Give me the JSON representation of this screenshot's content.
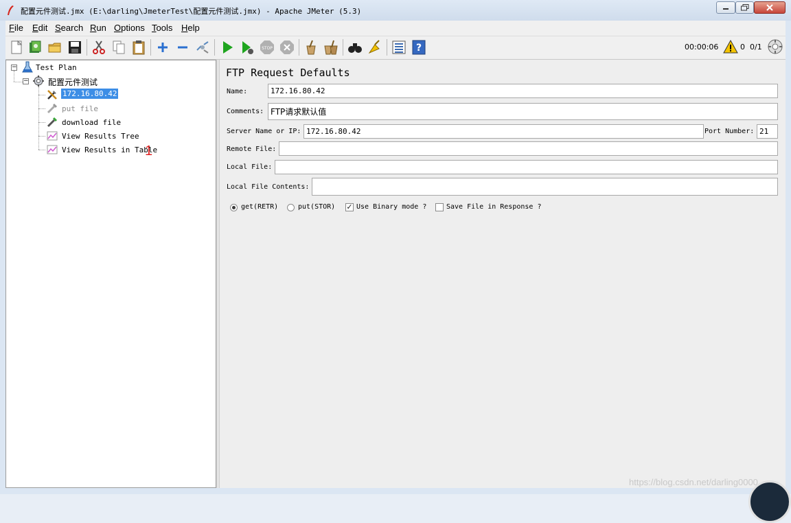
{
  "window": {
    "title": "配置元件测试.jmx (E:\\darling\\JmeterTest\\配置元件测试.jmx) - Apache JMeter (5.3)"
  },
  "menu": {
    "items": [
      {
        "mnemonic": "F",
        "rest": "ile"
      },
      {
        "mnemonic": "E",
        "rest": "dit"
      },
      {
        "mnemonic": "S",
        "rest": "earch"
      },
      {
        "mnemonic": "R",
        "rest": "un"
      },
      {
        "mnemonic": "O",
        "rest": "ptions"
      },
      {
        "mnemonic": "T",
        "rest": "ools"
      },
      {
        "mnemonic": "H",
        "rest": "elp"
      }
    ]
  },
  "toolbar": {
    "icons": [
      "new-icon",
      "templates-icon",
      "open-icon",
      "save-icon",
      "cut-icon",
      "copy-icon",
      "paste-icon",
      "expand-icon",
      "collapse-icon",
      "toggle-icon",
      "start-icon",
      "start-no-pause-icon",
      "stop-icon",
      "shutdown-icon",
      "clear-icon",
      "clear-all-icon",
      "search-icon",
      "reset-search-icon",
      "function-helper-icon",
      "help-icon"
    ],
    "timer": "00:00:06",
    "warning_count": "0",
    "threads": "0/1"
  },
  "tree": {
    "root": "Test Plan",
    "thread_group": "配置元件测试",
    "children": [
      {
        "label": "172.16.80.42",
        "selected": true,
        "disabled": false
      },
      {
        "label": "put file",
        "selected": false,
        "disabled": true
      },
      {
        "label": "download file",
        "selected": false,
        "disabled": false
      },
      {
        "label": "View Results Tree",
        "selected": false,
        "disabled": false
      },
      {
        "label": "View Results in Table",
        "selected": false,
        "disabled": false
      }
    ],
    "annotation": "1"
  },
  "panel": {
    "title": "FTP Request Defaults",
    "name_label": "Name:",
    "name_value": "172.16.80.42",
    "comments_label": "Comments:",
    "comments_value": "FTP请求默认值",
    "server_label": "Server Name or IP:",
    "server_value": "172.16.80.42",
    "port_label": "Port Number:",
    "port_value": "21",
    "remote_label": "Remote File:",
    "remote_value": "",
    "local_label": "Local File:",
    "local_value": "",
    "contents_label": "Local File Contents:",
    "contents_value": "",
    "get_label": "get(RETR)",
    "put_label": "put(STOR)",
    "binary_label": "Use Binary mode ?",
    "save_label": "Save File in Response ?",
    "get_selected": true,
    "binary_checked": true,
    "save_checked": false
  },
  "watermark": "https://blog.csdn.net/darling0000"
}
